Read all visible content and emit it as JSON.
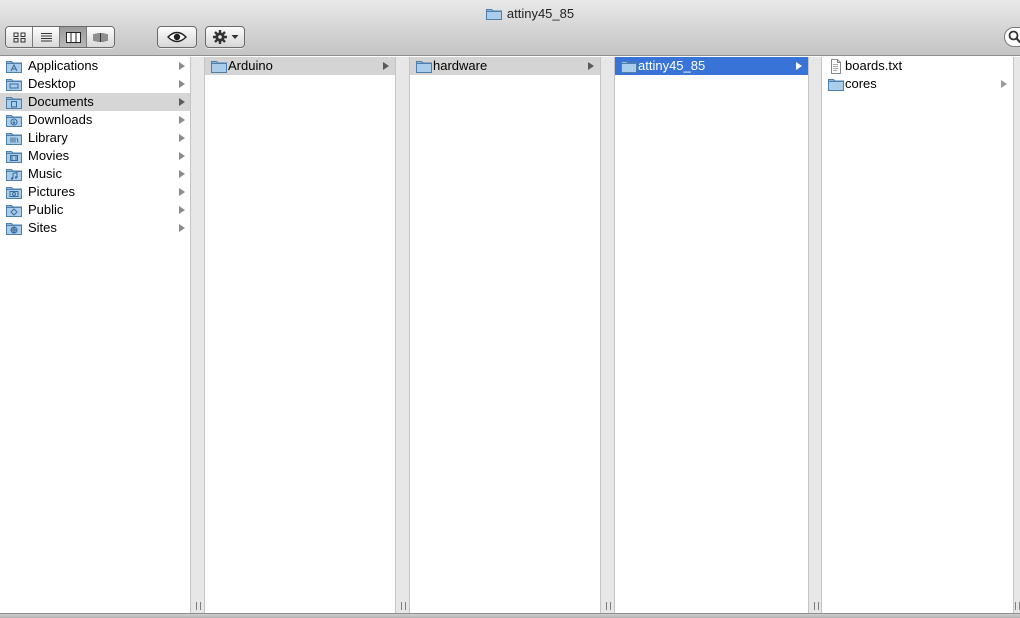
{
  "window": {
    "title": "attiny45_85"
  },
  "toolbar": {
    "view_buttons": [
      {
        "name": "icon-view-icon",
        "active": false
      },
      {
        "name": "list-view-icon",
        "active": false
      },
      {
        "name": "column-view-icon",
        "active": true
      },
      {
        "name": "cover-flow-view-icon",
        "active": false
      }
    ],
    "quicklook_icon": "eye-icon",
    "action_icon": "gear-icon",
    "search_icon": "search-icon"
  },
  "sidebar": {
    "items": [
      {
        "label": "Applications",
        "icon": "applications-folder-icon"
      },
      {
        "label": "Desktop",
        "icon": "desktop-folder-icon"
      },
      {
        "label": "Documents",
        "icon": "documents-folder-icon",
        "selected": true
      },
      {
        "label": "Downloads",
        "icon": "downloads-folder-icon"
      },
      {
        "label": "Library",
        "icon": "library-folder-icon"
      },
      {
        "label": "Movies",
        "icon": "movies-folder-icon"
      },
      {
        "label": "Music",
        "icon": "music-folder-icon"
      },
      {
        "label": "Pictures",
        "icon": "pictures-folder-icon"
      },
      {
        "label": "Public",
        "icon": "public-folder-icon"
      },
      {
        "label": "Sites",
        "icon": "sites-folder-icon"
      }
    ]
  },
  "columns": [
    {
      "items": [
        {
          "label": "Arduino",
          "kind": "folder",
          "state": "selected-grey"
        }
      ]
    },
    {
      "items": [
        {
          "label": "hardware",
          "kind": "folder",
          "state": "selected-grey"
        }
      ]
    },
    {
      "items": [
        {
          "label": "attiny45_85",
          "kind": "folder",
          "state": "selected-blue"
        }
      ]
    },
    {
      "items": [
        {
          "label": "boards.txt",
          "kind": "file",
          "state": "plain"
        },
        {
          "label": "cores",
          "kind": "folder",
          "state": "plain"
        }
      ]
    }
  ],
  "colors": {
    "selection_blue": "#3874d8",
    "selection_grey": "#d4d4d4",
    "folder_blue": "#8bb8df"
  }
}
